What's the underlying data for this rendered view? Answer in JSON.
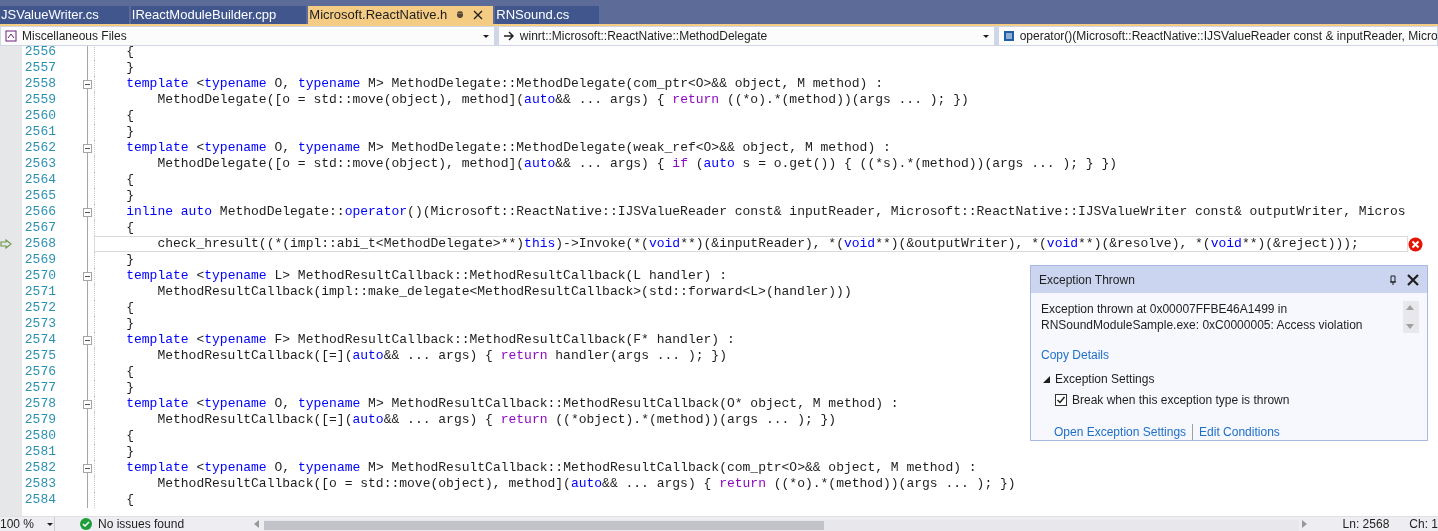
{
  "tabs": [
    {
      "label": "JSValueWriter.cs",
      "selected": false
    },
    {
      "label": "IReactModuleBuilder.cpp",
      "selected": false
    },
    {
      "label": "Microsoft.ReactNative.h",
      "selected": true
    },
    {
      "label": "RNSound.cs",
      "selected": false
    }
  ],
  "navigation": {
    "project": "Miscellaneous Files",
    "scope": "winrt::Microsoft::ReactNative::MethodDelegate",
    "member": "operator()(Microsoft::ReactNative::IJSValueReader const & inputReader, Micro"
  },
  "editor": {
    "lines": [
      {
        "number": "2556",
        "foldable": false,
        "current": false,
        "error": false,
        "tokens": [
          {
            "text": "    {",
            "kind": "plain"
          }
        ]
      },
      {
        "number": "2557",
        "foldable": false,
        "current": false,
        "error": false,
        "tokens": [
          {
            "text": "    }",
            "kind": "plain"
          }
        ]
      },
      {
        "number": "2558",
        "foldable": true,
        "current": false,
        "error": false,
        "tokens": [
          {
            "text": "    template",
            "kind": "keyword"
          },
          {
            "text": " <",
            "kind": "plain"
          },
          {
            "text": "typename",
            "kind": "keyword"
          },
          {
            "text": " O, ",
            "kind": "plain"
          },
          {
            "text": "typename",
            "kind": "keyword"
          },
          {
            "text": " M> MethodDelegate::MethodDelegate(com_ptr<O>&& object, M method) :",
            "kind": "plain"
          }
        ]
      },
      {
        "number": "2559",
        "foldable": false,
        "current": false,
        "error": false,
        "tokens": [
          {
            "text": "        MethodDelegate([o = std::move(object), method](",
            "kind": "plain"
          },
          {
            "text": "auto",
            "kind": "keyword"
          },
          {
            "text": "&& ... args) { ",
            "kind": "plain"
          },
          {
            "text": "return",
            "kind": "control"
          },
          {
            "text": " ((*o).*(method))(args ... ); })",
            "kind": "plain"
          }
        ]
      },
      {
        "number": "2560",
        "foldable": false,
        "current": false,
        "error": false,
        "tokens": [
          {
            "text": "    {",
            "kind": "plain"
          }
        ]
      },
      {
        "number": "2561",
        "foldable": false,
        "current": false,
        "error": false,
        "tokens": [
          {
            "text": "    }",
            "kind": "plain"
          }
        ]
      },
      {
        "number": "2562",
        "foldable": true,
        "current": false,
        "error": false,
        "tokens": [
          {
            "text": "    template",
            "kind": "keyword"
          },
          {
            "text": " <",
            "kind": "plain"
          },
          {
            "text": "typename",
            "kind": "keyword"
          },
          {
            "text": " O, ",
            "kind": "plain"
          },
          {
            "text": "typename",
            "kind": "keyword"
          },
          {
            "text": " M> MethodDelegate::MethodDelegate(weak_ref<O>&& object, M method) :",
            "kind": "plain"
          }
        ]
      },
      {
        "number": "2563",
        "foldable": false,
        "current": false,
        "error": false,
        "tokens": [
          {
            "text": "        MethodDelegate([o = std::move(object), method](",
            "kind": "plain"
          },
          {
            "text": "auto",
            "kind": "keyword"
          },
          {
            "text": "&& ... args) { ",
            "kind": "plain"
          },
          {
            "text": "if",
            "kind": "control"
          },
          {
            "text": " (",
            "kind": "plain"
          },
          {
            "text": "auto",
            "kind": "keyword"
          },
          {
            "text": " s = o.get()) { ((*s).*(method))(args ... ); } })",
            "kind": "plain"
          }
        ]
      },
      {
        "number": "2564",
        "foldable": false,
        "current": false,
        "error": false,
        "tokens": [
          {
            "text": "    {",
            "kind": "plain"
          }
        ]
      },
      {
        "number": "2565",
        "foldable": false,
        "current": false,
        "error": false,
        "tokens": [
          {
            "text": "    }",
            "kind": "plain"
          }
        ]
      },
      {
        "number": "2566",
        "foldable": true,
        "current": false,
        "error": false,
        "tokens": [
          {
            "text": "    inline auto",
            "kind": "keyword"
          },
          {
            "text": " MethodDelegate::",
            "kind": "plain"
          },
          {
            "text": "operator",
            "kind": "keyword"
          },
          {
            "text": "()(Microsoft::ReactNative::IJSValueReader const& inputReader, Microsoft::ReactNative::IJSValueWriter const& outputWriter, Micros",
            "kind": "plain"
          }
        ]
      },
      {
        "number": "2567",
        "foldable": false,
        "current": false,
        "error": false,
        "tokens": [
          {
            "text": "    {",
            "kind": "plain"
          }
        ]
      },
      {
        "number": "2568",
        "foldable": false,
        "current": true,
        "error": true,
        "tokens": [
          {
            "text": "        check_hresult((*(impl::abi_t<MethodDelegate>**)",
            "kind": "plain"
          },
          {
            "text": "this",
            "kind": "keyword"
          },
          {
            "text": ")->Invoke(*(",
            "kind": "plain"
          },
          {
            "text": "void",
            "kind": "keyword"
          },
          {
            "text": "**)(&inputReader), *(",
            "kind": "plain"
          },
          {
            "text": "void",
            "kind": "keyword"
          },
          {
            "text": "**)(&outputWriter), *(",
            "kind": "plain"
          },
          {
            "text": "void",
            "kind": "keyword"
          },
          {
            "text": "**)(&resolve), *(",
            "kind": "plain"
          },
          {
            "text": "void",
            "kind": "keyword"
          },
          {
            "text": "**)(&reject)));",
            "kind": "plain"
          }
        ]
      },
      {
        "number": "2569",
        "foldable": false,
        "current": false,
        "error": false,
        "tokens": [
          {
            "text": "    }",
            "kind": "plain"
          }
        ]
      },
      {
        "number": "2570",
        "foldable": true,
        "current": false,
        "error": false,
        "tokens": [
          {
            "text": "    template",
            "kind": "keyword"
          },
          {
            "text": " <",
            "kind": "plain"
          },
          {
            "text": "typename",
            "kind": "keyword"
          },
          {
            "text": " L> MethodResultCallback::MethodResultCallback(L handler) :",
            "kind": "plain"
          }
        ]
      },
      {
        "number": "2571",
        "foldable": false,
        "current": false,
        "error": false,
        "tokens": [
          {
            "text": "        MethodResultCallback(impl::make_delegate<MethodResultCallback>(std::forward<L>(handler)))",
            "kind": "plain"
          }
        ]
      },
      {
        "number": "2572",
        "foldable": false,
        "current": false,
        "error": false,
        "tokens": [
          {
            "text": "    {",
            "kind": "plain"
          }
        ]
      },
      {
        "number": "2573",
        "foldable": false,
        "current": false,
        "error": false,
        "tokens": [
          {
            "text": "    }",
            "kind": "plain"
          }
        ]
      },
      {
        "number": "2574",
        "foldable": true,
        "current": false,
        "error": false,
        "tokens": [
          {
            "text": "    template",
            "kind": "keyword"
          },
          {
            "text": " <",
            "kind": "plain"
          },
          {
            "text": "typename",
            "kind": "keyword"
          },
          {
            "text": " F> MethodResultCallback::MethodResultCallback(F* handler) :",
            "kind": "plain"
          }
        ]
      },
      {
        "number": "2575",
        "foldable": false,
        "current": false,
        "error": false,
        "tokens": [
          {
            "text": "        MethodResultCallback([=](",
            "kind": "plain"
          },
          {
            "text": "auto",
            "kind": "keyword"
          },
          {
            "text": "&& ... args) { ",
            "kind": "plain"
          },
          {
            "text": "return",
            "kind": "control"
          },
          {
            "text": " handler(args ... ); })",
            "kind": "plain"
          }
        ]
      },
      {
        "number": "2576",
        "foldable": false,
        "current": false,
        "error": false,
        "tokens": [
          {
            "text": "    {",
            "kind": "plain"
          }
        ]
      },
      {
        "number": "2577",
        "foldable": false,
        "current": false,
        "error": false,
        "tokens": [
          {
            "text": "    }",
            "kind": "plain"
          }
        ]
      },
      {
        "number": "2578",
        "foldable": true,
        "current": false,
        "error": false,
        "tokens": [
          {
            "text": "    template",
            "kind": "keyword"
          },
          {
            "text": " <",
            "kind": "plain"
          },
          {
            "text": "typename",
            "kind": "keyword"
          },
          {
            "text": " O, ",
            "kind": "plain"
          },
          {
            "text": "typename",
            "kind": "keyword"
          },
          {
            "text": " M> MethodResultCallback::MethodResultCallback(O* object, M method) :",
            "kind": "plain"
          }
        ]
      },
      {
        "number": "2579",
        "foldable": false,
        "current": false,
        "error": false,
        "tokens": [
          {
            "text": "        MethodResultCallback([=](",
            "kind": "plain"
          },
          {
            "text": "auto",
            "kind": "keyword"
          },
          {
            "text": "&& ... args) { ",
            "kind": "plain"
          },
          {
            "text": "return",
            "kind": "control"
          },
          {
            "text": " ((*object).*(method))(args ... ); })",
            "kind": "plain"
          }
        ]
      },
      {
        "number": "2580",
        "foldable": false,
        "current": false,
        "error": false,
        "tokens": [
          {
            "text": "    {",
            "kind": "plain"
          }
        ]
      },
      {
        "number": "2581",
        "foldable": false,
        "current": false,
        "error": false,
        "tokens": [
          {
            "text": "    }",
            "kind": "plain"
          }
        ]
      },
      {
        "number": "2582",
        "foldable": true,
        "current": false,
        "error": false,
        "tokens": [
          {
            "text": "    template",
            "kind": "keyword"
          },
          {
            "text": " <",
            "kind": "plain"
          },
          {
            "text": "typename",
            "kind": "keyword"
          },
          {
            "text": " O, ",
            "kind": "plain"
          },
          {
            "text": "typename",
            "kind": "keyword"
          },
          {
            "text": " M> MethodResultCallback::MethodResultCallback(com_ptr<O>&& object, M method) :",
            "kind": "plain"
          }
        ]
      },
      {
        "number": "2583",
        "foldable": false,
        "current": false,
        "error": false,
        "tokens": [
          {
            "text": "        MethodResultCallback([o = std::move(object), method](",
            "kind": "plain"
          },
          {
            "text": "auto",
            "kind": "keyword"
          },
          {
            "text": "&& ... args) { ",
            "kind": "plain"
          },
          {
            "text": "return",
            "kind": "control"
          },
          {
            "text": " ((*o).*(method))(args ... ); })",
            "kind": "plain"
          }
        ]
      },
      {
        "number": "2584",
        "foldable": false,
        "current": false,
        "error": false,
        "tokens": [
          {
            "text": "    {",
            "kind": "plain"
          }
        ]
      }
    ]
  },
  "exception": {
    "title": "Exception Thrown",
    "message": "Exception thrown at 0x00007FFBE46A1499 in RNSoundModuleSample.exe: 0xC0000005: Access violation",
    "copy_link": "Copy Details",
    "settings": {
      "heading": "Exception Settings",
      "expanded": true,
      "checkbox_label": "Break when this exception type is thrown",
      "checked": true
    },
    "links": [
      "Open Exception Settings",
      "Edit Conditions"
    ]
  },
  "status_bar": {
    "zoom": "100 %",
    "issues": "No issues found",
    "line": "Ln: 2568",
    "column": "Ch: 1"
  }
}
